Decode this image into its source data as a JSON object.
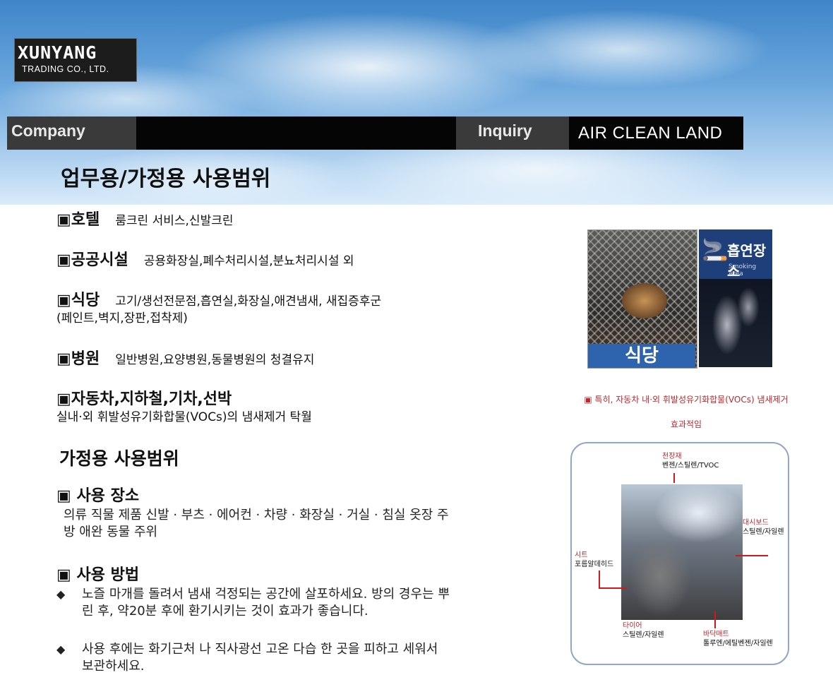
{
  "header": {
    "logo_main": "XUNYANG",
    "logo_sub": "TRADING CO., LTD.",
    "nav": {
      "company": "Company",
      "inquiry": "Inquiry",
      "brand": "AIR CLEAN LAND"
    },
    "page_title": "업무용/가정용 사용범위"
  },
  "business_uses": [
    {
      "marker": "▣",
      "head": "호텔",
      "desc": "룸크린 서비스,신발크린",
      "cont": ""
    },
    {
      "marker": "▣",
      "head": "공공시설",
      "desc": "공용화장실,폐수처리시설,분뇨처리시설 외",
      "cont": ""
    },
    {
      "marker": "▣",
      "head": "식당",
      "desc": "고기/생선전문점,흡연실,화장실,애견냄새, 새집증후군",
      "cont": "(페인트,벽지,장판,접착제)"
    },
    {
      "marker": "▣",
      "head": "병원",
      "desc": "일반병원,요양병원,동물병원의 청결유지",
      "cont": ""
    },
    {
      "marker": "▣",
      "head": "자동차,지하철,기차,선박",
      "desc": "",
      "cont": "실내·외 휘발성유기화합물(VOCs)의 냄새제거 탁월"
    }
  ],
  "home": {
    "title": "가정용 사용범위",
    "place_heading": "▣ 사용 장소",
    "place_text": "의류 직물 제품 신발 · 부츠 · 에어컨 · 차량 · 화장실 · 거실 · 침실 옷장 주방 애완 동물 주위",
    "method_heading": "▣ 사용 방법",
    "bullet_marker": "◆",
    "methods": [
      "노즐 마개를 돌려서 냄새 걱정되는 공간에 살포하세요. 방의 경우는 뿌린 후, 약20분 후에 환기시키는 것이 효과가 좋습니다.",
      "사용 후에는 화기근처 나 직사광선 고온 다습 한 곳을 피하고 세워서 보관하세요."
    ]
  },
  "right": {
    "food_label": "식당",
    "smoking_sign": "흡연장소",
    "smoking_sign_en": "Smoking Area",
    "note_line1": "▣ 특히, 자동차 내·외 휘발성유기화합물(VOCs) 냄새제거",
    "note_line2": "효과적임",
    "car_labels": {
      "ceiling_title": "천장재",
      "ceiling_desc": "벤젠/스틸렌/TVOC",
      "dash_title": "대시보드",
      "dash_desc": "스틸렌/자일렌",
      "seat_title": "시트",
      "seat_desc": "포름알데히드",
      "tire_title": "타이어",
      "tire_desc": "스틸렌/자일렌",
      "floor_title": "바닥매트",
      "floor_desc": "톨루엔/에틸벤젠/자일렌"
    }
  },
  "colors": {
    "nav_bg": "#050505",
    "nav_tab": "#3a3a3a",
    "label_blue": "#2e64ad",
    "note_red": "#c0262b",
    "arrow_red": "#d01a1a"
  }
}
